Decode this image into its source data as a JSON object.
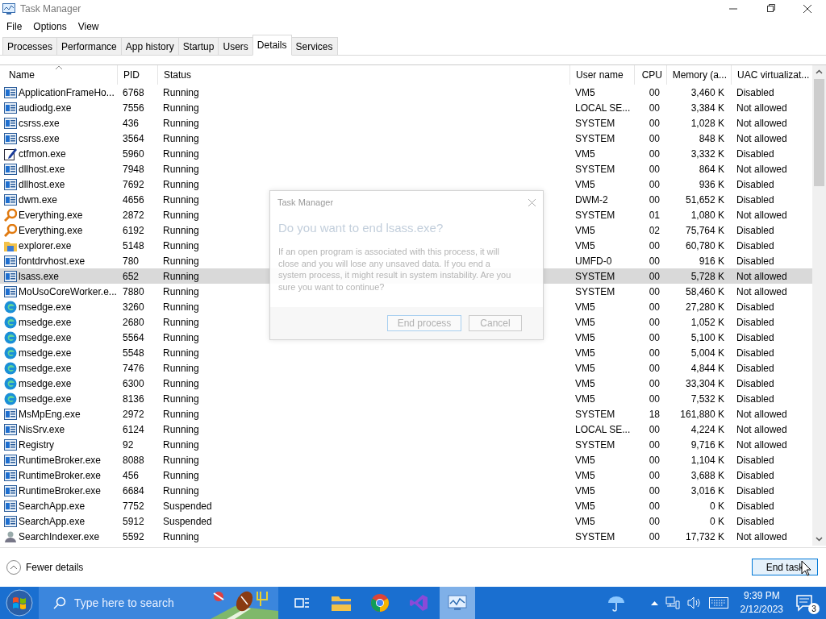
{
  "window": {
    "title": "Task Manager"
  },
  "menu": [
    "File",
    "Options",
    "View"
  ],
  "tabs": [
    {
      "label": "Processes",
      "selected": false
    },
    {
      "label": "Performance",
      "selected": false
    },
    {
      "label": "App history",
      "selected": false
    },
    {
      "label": "Startup",
      "selected": false
    },
    {
      "label": "Users",
      "selected": false
    },
    {
      "label": "Details",
      "selected": true
    },
    {
      "label": "Services",
      "selected": false
    }
  ],
  "table": {
    "columns": [
      "Name",
      "PID",
      "Status",
      "User name",
      "CPU",
      "Memory (a...",
      "UAC virtualizat..."
    ],
    "rows": [
      {
        "kind": "app",
        "cells": [
          "ApplicationFrameHo...",
          "6768",
          "Running",
          "VM5",
          "00",
          "3,460 K",
          "Disabled"
        ],
        "selected": false
      },
      {
        "kind": "app",
        "cells": [
          "audiodg.exe",
          "7556",
          "Running",
          "LOCAL SE...",
          "00",
          "3,384 K",
          "Not allowed"
        ],
        "selected": false
      },
      {
        "kind": "app",
        "cells": [
          "csrss.exe",
          "436",
          "Running",
          "SYSTEM",
          "00",
          "1,028 K",
          "Not allowed"
        ],
        "selected": false
      },
      {
        "kind": "app",
        "cells": [
          "csrss.exe",
          "3564",
          "Running",
          "SYSTEM",
          "00",
          "848 K",
          "Not allowed"
        ],
        "selected": false
      },
      {
        "kind": "pen",
        "cells": [
          "ctfmon.exe",
          "5960",
          "Running",
          "VM5",
          "00",
          "3,332 K",
          "Disabled"
        ],
        "selected": false
      },
      {
        "kind": "app",
        "cells": [
          "dllhost.exe",
          "7948",
          "Running",
          "SYSTEM",
          "00",
          "864 K",
          "Not allowed"
        ],
        "selected": false
      },
      {
        "kind": "app",
        "cells": [
          "dllhost.exe",
          "7692",
          "Running",
          "VM5",
          "00",
          "936 K",
          "Disabled"
        ],
        "selected": false
      },
      {
        "kind": "app",
        "cells": [
          "dwm.exe",
          "4656",
          "Running",
          "DWM-2",
          "00",
          "51,652 K",
          "Disabled"
        ],
        "selected": false
      },
      {
        "kind": "key",
        "cells": [
          "Everything.exe",
          "2872",
          "Running",
          "SYSTEM",
          "01",
          "1,080 K",
          "Not allowed"
        ],
        "selected": false
      },
      {
        "kind": "key",
        "cells": [
          "Everything.exe",
          "6192",
          "Running",
          "VM5",
          "02",
          "75,764 K",
          "Disabled"
        ],
        "selected": false
      },
      {
        "kind": "folder",
        "cells": [
          "explorer.exe",
          "5148",
          "Running",
          "VM5",
          "00",
          "60,780 K",
          "Disabled"
        ],
        "selected": false
      },
      {
        "kind": "app",
        "cells": [
          "fontdrvhost.exe",
          "780",
          "Running",
          "UMFD-0",
          "00",
          "916 K",
          "Disabled"
        ],
        "selected": false
      },
      {
        "kind": "app",
        "cells": [
          "lsass.exe",
          "652",
          "Running",
          "SYSTEM",
          "00",
          "5,728 K",
          "Not allowed"
        ],
        "selected": true
      },
      {
        "kind": "app",
        "cells": [
          "MoUsoCoreWorker.e...",
          "7880",
          "Running",
          "SYSTEM",
          "00",
          "58,460 K",
          "Not allowed"
        ],
        "selected": false
      },
      {
        "kind": "edge",
        "cells": [
          "msedge.exe",
          "3260",
          "Running",
          "VM5",
          "00",
          "27,280 K",
          "Disabled"
        ],
        "selected": false
      },
      {
        "kind": "edge",
        "cells": [
          "msedge.exe",
          "2680",
          "Running",
          "VM5",
          "00",
          "1,052 K",
          "Disabled"
        ],
        "selected": false
      },
      {
        "kind": "edge",
        "cells": [
          "msedge.exe",
          "5564",
          "Running",
          "VM5",
          "00",
          "5,100 K",
          "Disabled"
        ],
        "selected": false
      },
      {
        "kind": "edge",
        "cells": [
          "msedge.exe",
          "5548",
          "Running",
          "VM5",
          "00",
          "5,004 K",
          "Disabled"
        ],
        "selected": false
      },
      {
        "kind": "edge",
        "cells": [
          "msedge.exe",
          "7476",
          "Running",
          "VM5",
          "00",
          "4,844 K",
          "Disabled"
        ],
        "selected": false
      },
      {
        "kind": "edge",
        "cells": [
          "msedge.exe",
          "6300",
          "Running",
          "VM5",
          "00",
          "33,304 K",
          "Disabled"
        ],
        "selected": false
      },
      {
        "kind": "edge",
        "cells": [
          "msedge.exe",
          "8136",
          "Running",
          "VM5",
          "00",
          "7,532 K",
          "Disabled"
        ],
        "selected": false
      },
      {
        "kind": "app",
        "cells": [
          "MsMpEng.exe",
          "2972",
          "Running",
          "SYSTEM",
          "18",
          "161,880 K",
          "Not allowed"
        ],
        "selected": false
      },
      {
        "kind": "app",
        "cells": [
          "NisSrv.exe",
          "6124",
          "Running",
          "LOCAL SE...",
          "00",
          "4,224 K",
          "Not allowed"
        ],
        "selected": false
      },
      {
        "kind": "app",
        "cells": [
          "Registry",
          "92",
          "Running",
          "SYSTEM",
          "00",
          "9,716 K",
          "Not allowed"
        ],
        "selected": false
      },
      {
        "kind": "app",
        "cells": [
          "RuntimeBroker.exe",
          "8088",
          "Running",
          "VM5",
          "00",
          "1,104 K",
          "Disabled"
        ],
        "selected": false
      },
      {
        "kind": "app",
        "cells": [
          "RuntimeBroker.exe",
          "456",
          "Running",
          "VM5",
          "00",
          "3,688 K",
          "Disabled"
        ],
        "selected": false
      },
      {
        "kind": "app",
        "cells": [
          "RuntimeBroker.exe",
          "6684",
          "Running",
          "VM5",
          "00",
          "3,016 K",
          "Disabled"
        ],
        "selected": false
      },
      {
        "kind": "app",
        "cells": [
          "SearchApp.exe",
          "7752",
          "Suspended",
          "VM5",
          "00",
          "0 K",
          "Disabled"
        ],
        "selected": false
      },
      {
        "kind": "app",
        "cells": [
          "SearchApp.exe",
          "5912",
          "Suspended",
          "VM5",
          "00",
          "0 K",
          "Disabled"
        ],
        "selected": false
      },
      {
        "kind": "person",
        "cells": [
          "SearchIndexer.exe",
          "5592",
          "Running",
          "SYSTEM",
          "00",
          "17,732 K",
          "Not allowed"
        ],
        "selected": false
      }
    ]
  },
  "footer": {
    "toggle": "Fewer details",
    "button": "End task"
  },
  "dialog": {
    "title": "Task Manager",
    "heading": "Do you want to end lsass.exe?",
    "message": "If an open program is associated with this process, it will close and you will lose any unsaved data. If you end a system process, it might result in system instability. Are you sure you want to continue?",
    "buttons": [
      "End process",
      "Cancel"
    ]
  },
  "taskbar": {
    "search_placeholder": "Type here to search",
    "time": "9:39 PM",
    "date": "2/12/2023",
    "notifications": "3"
  }
}
